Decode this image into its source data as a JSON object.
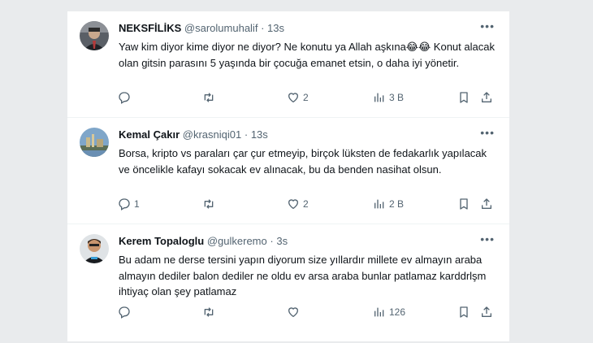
{
  "tweets": [
    {
      "name": "NEKSFİLİKS",
      "handle": "@sarolumuhalif",
      "sep": "·",
      "time": "13s",
      "text": "Yaw kim diyor kime diyor ne diyor? Ne konutu ya Allah aşkına😂😂 Konut alacak olan gitsin parasını 5 yaşında bir çocuğa emanet etsin, o daha iyi yönetir.",
      "replies": "",
      "retweets": "",
      "likes": "2",
      "views": "3 B"
    },
    {
      "name": "Kemal Çakır",
      "handle": "@krasniqi01",
      "sep": "·",
      "time": "13s",
      "text": "Borsa, kripto vs paraları çar çur etmeyip, birçok lüksten de fedakarlık yapılacak ve öncelikle kafayı sokacak ev alınacak, bu da benden nasihat olsun.",
      "replies": "1",
      "retweets": "",
      "likes": "2",
      "views": "2 B"
    },
    {
      "name": "Kerem Topaloglu",
      "handle": "@gulkeremo",
      "sep": "·",
      "time": "3s",
      "text": "Bu adam ne derse tersini yapın diyorum size yıllardır millete ev almayın araba almayın dediler balon dediler ne oldu ev arsa araba bunlar patlamaz karddrlşm ihtiyaç olan şey patlamaz",
      "replies": "",
      "retweets": "",
      "likes": "",
      "views": "126"
    }
  ],
  "icons": {
    "more": "more-horizontal-icon",
    "reply": "reply-icon",
    "retweet": "retweet-icon",
    "like": "heart-icon",
    "views": "views-chart-icon",
    "bookmark": "bookmark-icon",
    "share": "share-icon"
  },
  "colors": {
    "text": "#0f1419",
    "secondary": "#536471",
    "divider": "#eff3f4"
  }
}
